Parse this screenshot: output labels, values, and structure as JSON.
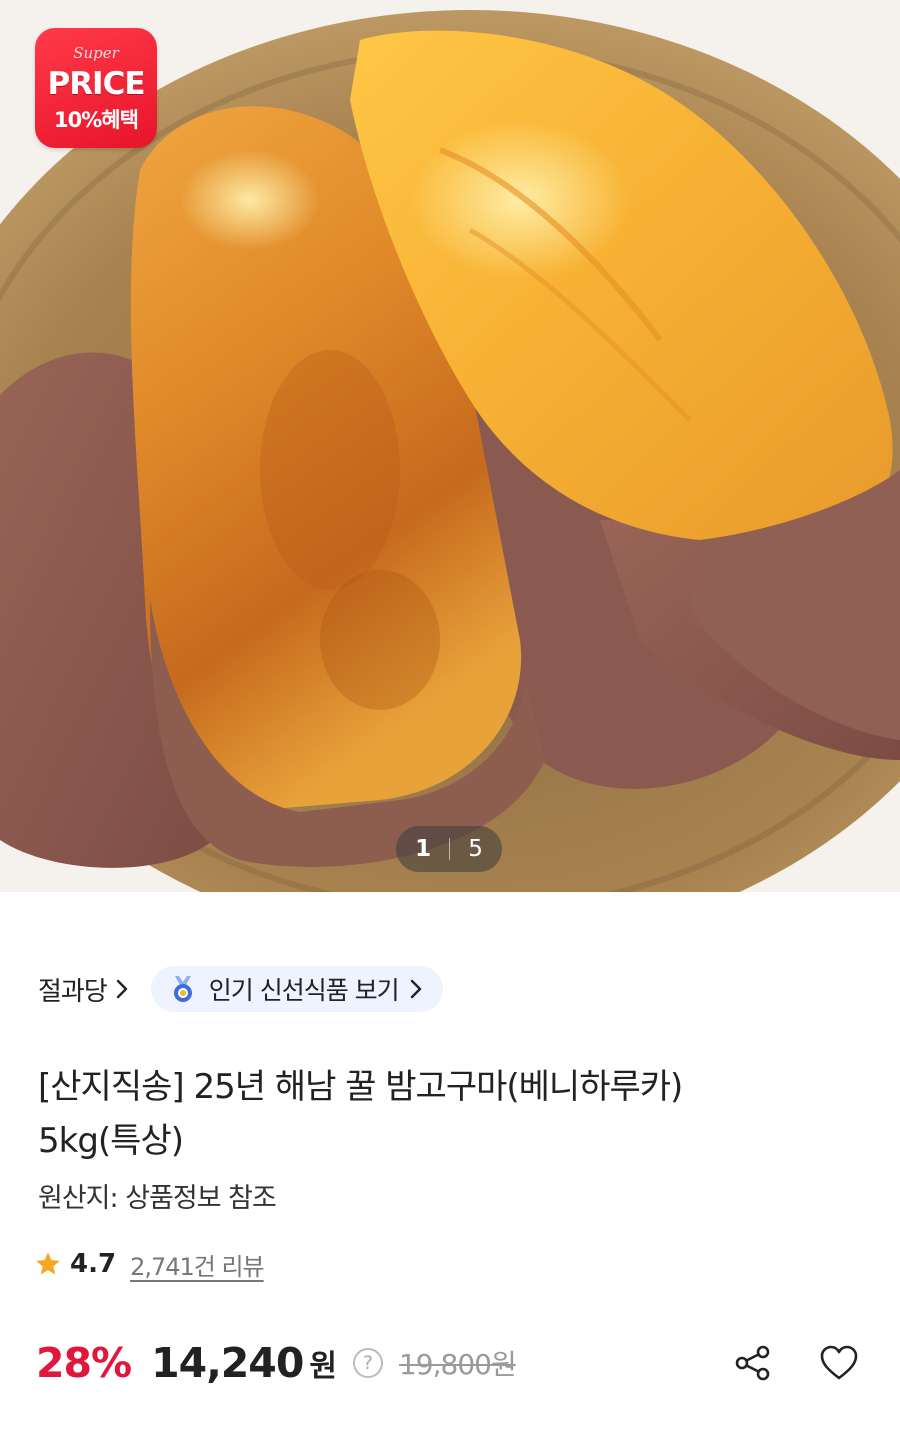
{
  "hero": {
    "image_alt": "roasted sweet potatoes",
    "promo_badge": {
      "script_text": "Super",
      "headline": "PRICE",
      "benefit": "10%혜택"
    },
    "pager": {
      "current": "1",
      "total": "5"
    }
  },
  "store": {
    "name": "절과당",
    "chevron_icon": "chevron-right-icon"
  },
  "fresh_chip": {
    "icon": "medal-icon",
    "label": "인기 신선식품 보기"
  },
  "product": {
    "title_line1": "[산지직송] 25년 해남 꿀 밤고구마(베니하루카)",
    "title_line2": "5kg(특상)",
    "origin": "원산지: 상품정보 참조"
  },
  "rating": {
    "icon": "star-icon",
    "score": "4.7",
    "reviews": "2,741건 리뷰"
  },
  "price": {
    "discount": "28%",
    "sale": "14,240",
    "currency": "원",
    "help_glyph": "?",
    "original": "19,800원"
  },
  "actions": {
    "share_icon": "share-icon",
    "like_icon": "heart-icon"
  },
  "colors": {
    "accent_red": "#e0173a",
    "chip_bg": "#eef3ff",
    "badge_red": "#e8142b"
  }
}
